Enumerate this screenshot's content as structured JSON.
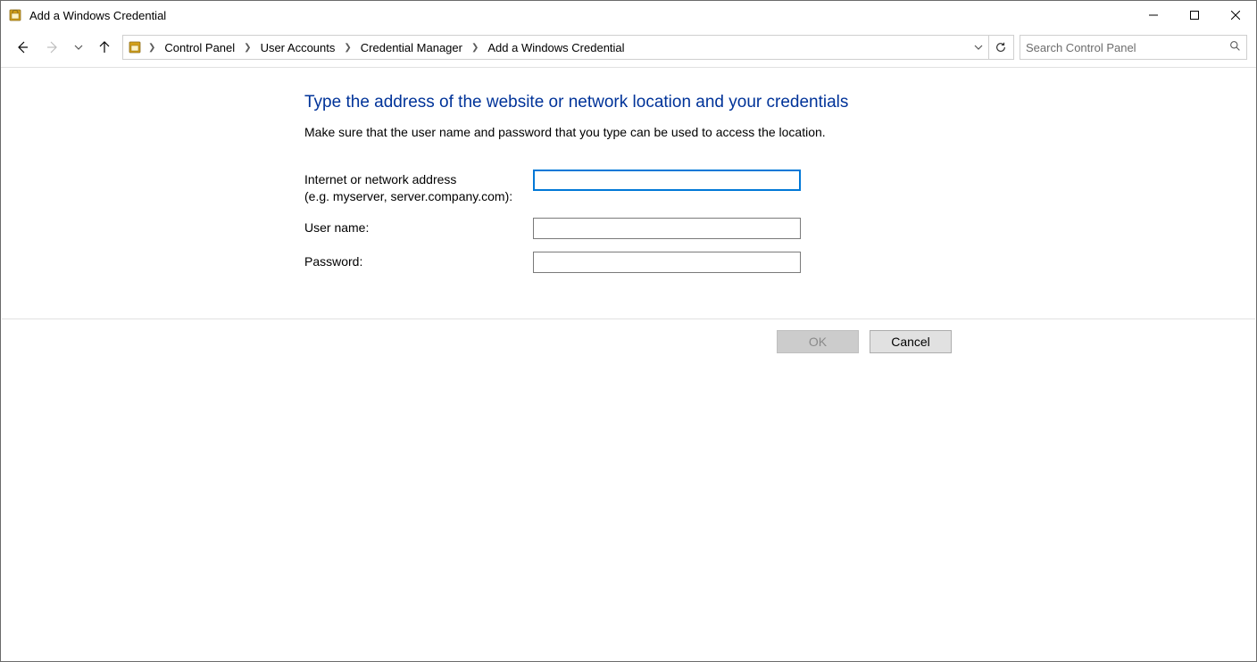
{
  "window": {
    "title": "Add a Windows Credential"
  },
  "breadcrumbs": {
    "items": [
      "Control Panel",
      "User Accounts",
      "Credential Manager",
      "Add a Windows Credential"
    ]
  },
  "search": {
    "placeholder": "Search Control Panel"
  },
  "page": {
    "heading": "Type the address of the website or network location and your credentials",
    "subtext": "Make sure that the user name and password that you type can be used to access the location."
  },
  "form": {
    "address_label_line1": "Internet or network address",
    "address_label_line2": "(e.g. myserver, server.company.com):",
    "address_value": "",
    "username_label": "User name:",
    "username_value": "",
    "password_label": "Password:",
    "password_value": ""
  },
  "buttons": {
    "ok": "OK",
    "cancel": "Cancel"
  }
}
